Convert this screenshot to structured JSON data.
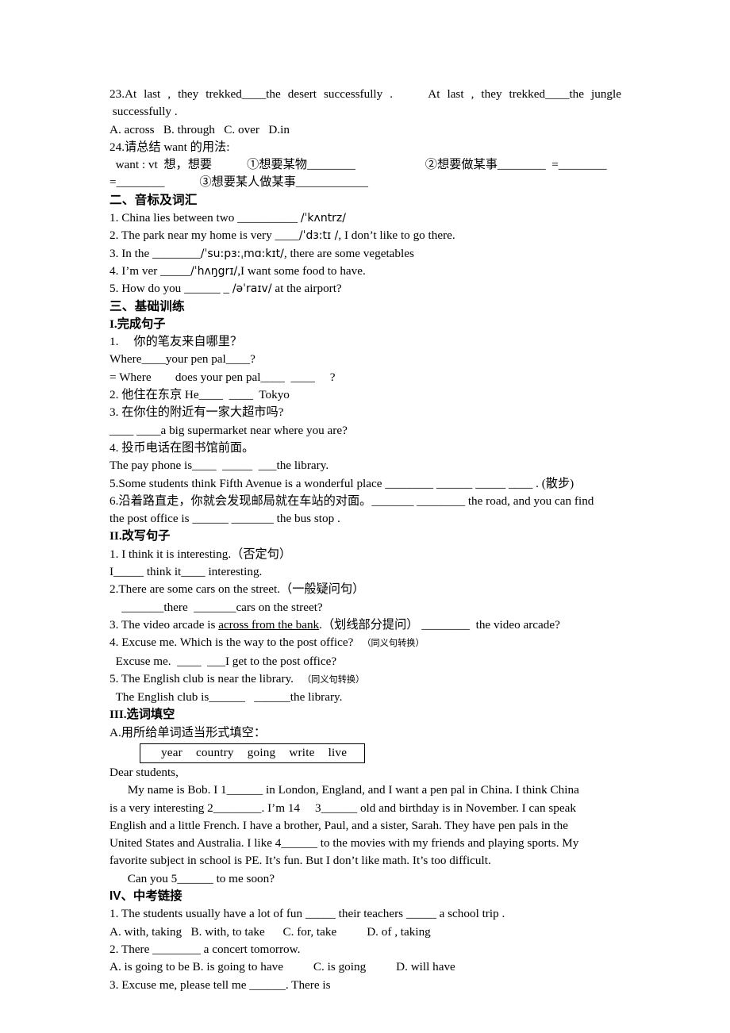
{
  "document": {
    "type": "english-exercise-worksheet",
    "language": "zh-CN-with-English"
  },
  "q23": {
    "line1": "23.At last , they trekked____the desert successfully .     At last , they trekked____the jungle",
    "line2": " successfully .",
    "options": "A. across   B. through   C. over   D.in"
  },
  "q24": {
    "prompt": "24.请总结 want 的用法:",
    "line1_a": "  want : vt  想，想要",
    "line1_b": "①想要某物________",
    "line1_c": "②想要做某事________  =________",
    "line2_a": "=________",
    "line2_b": "③想要某人做某事____________"
  },
  "section2": {
    "heading": "二、音标及词汇",
    "items": [
      {
        "pre": "1. China lies between two __________ ",
        "ipa": "/ˈkʌntrz/",
        "post": ""
      },
      {
        "pre": "2. The park near my home is very ____",
        "ipa": "/ˈdɜ:tɪ /",
        "post": ", I don’t like to go there."
      },
      {
        "pre": "3. In the ________",
        "ipa": "/ˈsu:pɜ:ˌmɑ:kɪt/",
        "post": ", there are some vegetables"
      },
      {
        "pre": "4. I’m ver _____",
        "ipa": "/ˈhʌŋgrɪ/",
        "post": ",I want some food to have."
      },
      {
        "pre": "5. How do you ______ _ ",
        "ipa": "/əˈraɪv/",
        "post": " at the airport?"
      }
    ]
  },
  "section3": {
    "heading": "三、基础训练",
    "part1": {
      "heading": "I.完成句子",
      "lines": [
        "1.　 你的笔友来自哪里？",
        "Where____your pen pal____?",
        "= Where        does your pen pal____  ____     ?",
        "2. 他住在东京 He____  ____  Tokyo",
        "3. 在你住的附近有一家大超市吗?",
        "____ ____a big supermarket near where you are?",
        "4. 投币电话在图书馆前面。",
        "The pay phone is____  _____  ___the library.",
        "5.Some students think Fifth Avenue is a wonderful place ________ ______ _____ ____ . (散步)",
        "6.沿着路直走，你就会发现邮局就在车站的对面。_______ ________ the road, and you can find",
        "the post office is ______ _______ the bus stop ."
      ]
    },
    "part2": {
      "heading": "II.改写句子",
      "q1": {
        "line1": "1. I think it is interesting.（否定句）",
        "line2": "I_____ think it____ interesting."
      },
      "q2": {
        "line1": "2.There are some cars on the street.（一般疑问句）",
        "line2": "    _______there  _______cars on the street?"
      },
      "q3": {
        "pre": "3. The video arcade is ",
        "underlined": "across from the bank",
        "mid": ".（划线部分提问）",
        "post": " ________  the video arcade?"
      },
      "q4": {
        "line1": "4. Excuse me. Which is the way to the post office?",
        "ann": "（同义句转换）",
        "line2": "  Excuse me.  ____  ___I get to the post office?"
      },
      "q5": {
        "line1": "5. The English club is near the library.",
        "ann": "（同义句转换）",
        "line2": "  The English club is______   ______the library."
      }
    },
    "part3": {
      "heading": "III.选词填空",
      "instruction": "A.用所给单词适当形式填空：",
      "wordbank": [
        "year",
        "country",
        "going",
        "write",
        "live"
      ],
      "salutation": "Dear students,",
      "body": [
        "      My name is Bob. I 1______ in London, England, and I want a pen pal in China. I think China",
        "is a very interesting 2________. I’m 14　 3______ old and birthday is in November. I can speak",
        "English and a little French. I have a brother, Paul, and a sister, Sarah. They have pen pals in the",
        "United States and Australia. I like 4______ to the movies with my friends and playing sports. My",
        "favorite subject in school is PE. It’s fun. But I don’t like math. It’s too difficult.",
        "      Can you 5______ to me soon?"
      ]
    }
  },
  "section4": {
    "heading": "IV、中考链接",
    "items": [
      {
        "question": "1. The students usually have a lot of fun _____ their teachers _____ a school trip .",
        "options": "A. with, taking   B. with, to take      C. for, take          D. of , taking"
      },
      {
        "question": "2. There ________ a concert tomorrow.",
        "options": "A. is going to be B. is going to have          C. is going          D. will have"
      },
      {
        "question": "3. Excuse me, please tell me ______. There is",
        "options": ""
      }
    ]
  }
}
